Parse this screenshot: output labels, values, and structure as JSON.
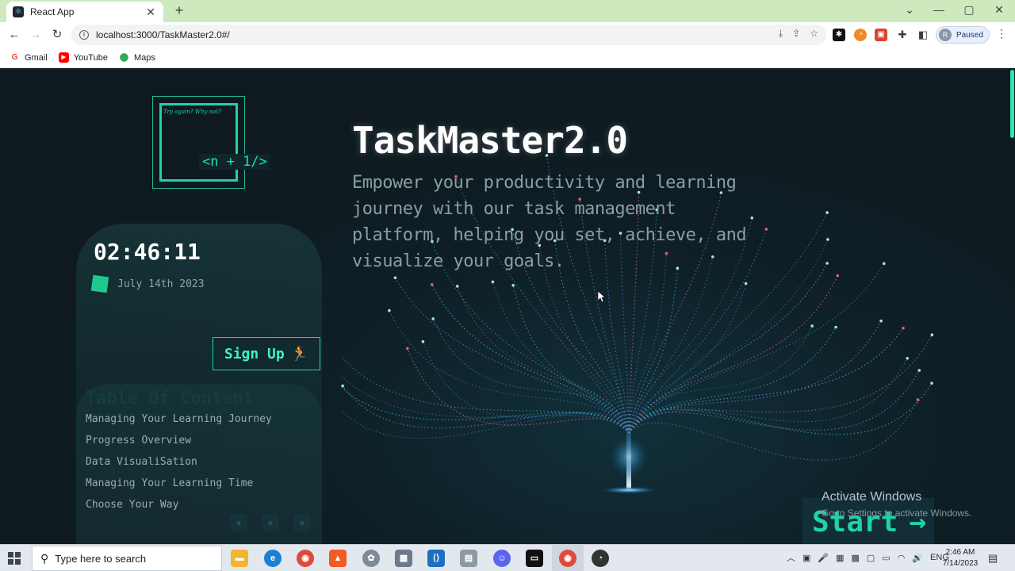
{
  "browser": {
    "tab_title": "React App",
    "tab_favicon": "react-icon",
    "new_tab": "+",
    "url": "localhost:3000/TaskMaster2.0#/",
    "profile_initial": "R",
    "profile_status": "Paused",
    "bookmarks": [
      {
        "label": "Gmail",
        "icon": "gmail-icon",
        "color": "#ea4335"
      },
      {
        "label": "YouTube",
        "icon": "youtube-icon",
        "color": "#ff0000"
      },
      {
        "label": "Maps",
        "icon": "maps-icon",
        "color": "#34a853"
      }
    ]
  },
  "app": {
    "logo_tagline": "Try again? Why not?",
    "logo_code": "<n + 1/>",
    "clock": "02:46:11",
    "date": "July 14th 2023",
    "signup_label": "Sign Up",
    "signup_icon": "🏃",
    "toc_title": "Table Of Content",
    "toc_items": [
      "Managing Your Learning Journey",
      "Progress Overview",
      "Data VisualiSation",
      "Managing Your Learning Time",
      "Choose Your Way"
    ],
    "hero_title": "TaskMaster2.0",
    "hero_description": "Empower your productivity and learning journey with our task management platform, helping you set, achieve, and visualize your goals.",
    "start_label": "Start",
    "start_arrow": "→",
    "accent_color": "#1fd3a7"
  },
  "windows": {
    "activate_title": "Activate Windows",
    "activate_sub": "Go to Settings to activate Windows.",
    "search_placeholder": "Type here to search",
    "tray_lang": "ENG",
    "time": "2:46 AM",
    "date": "7/14/2023"
  }
}
